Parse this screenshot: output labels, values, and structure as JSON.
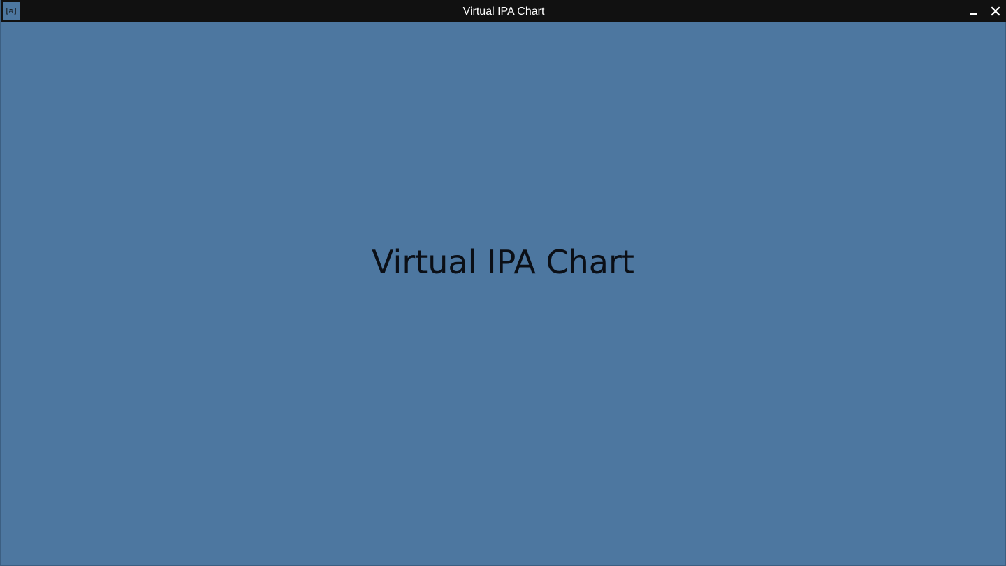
{
  "window": {
    "title": "Virtual IPA Chart",
    "app_icon_glyph": "[ə]",
    "controls": {
      "minimize_icon": "minimize-icon",
      "close_icon": "close-icon"
    }
  },
  "main": {
    "splash_title": "Virtual IPA Chart"
  },
  "colors": {
    "titlebar_bg": "#111111",
    "content_bg": "#4d77a0",
    "title_text": "#ffffff",
    "splash_text": "#0b0f16"
  }
}
